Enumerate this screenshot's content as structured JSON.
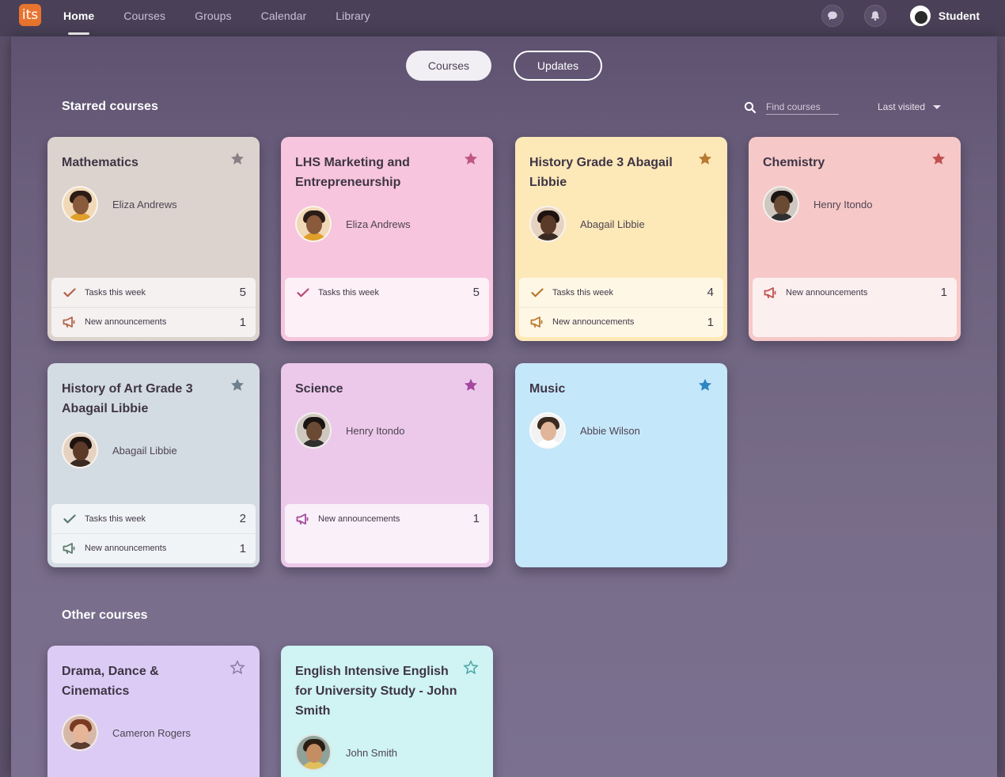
{
  "topbar": {
    "logo_text": "its",
    "nav": [
      {
        "label": "Home",
        "active": true
      },
      {
        "label": "Courses"
      },
      {
        "label": "Groups"
      },
      {
        "label": "Calendar"
      },
      {
        "label": "Library"
      }
    ],
    "icons": {
      "messages": "chat-bubble-icon",
      "notifications": "bell-icon"
    },
    "user_label": "Student"
  },
  "view_toggle": {
    "courses_label": "Courses",
    "updates_label": "Updates",
    "selected": "Courses"
  },
  "starred": {
    "title": "Starred courses",
    "search_placeholder": "Find courses",
    "sort_label": "Last visited"
  },
  "other": {
    "title": "Other courses"
  },
  "stat_labels": {
    "tasks": "Tasks this week",
    "announcements": "New announcements"
  },
  "courses": [
    {
      "id": "mathematics",
      "title": "Mathematics",
      "teacher": "Eliza Andrews",
      "starred": true,
      "tasks": "5",
      "announcements": "1",
      "bg": "#dcd3cf",
      "star_color": "#8a7f85",
      "stats_bg": "#f4f1f0",
      "accent": "#b5634a"
    },
    {
      "id": "lhs-marketing",
      "title": "LHS Marketing and Entrepreneurship",
      "teacher": "Eliza Andrews",
      "starred": true,
      "tasks": "5",
      "bg": "#f7c5dd",
      "star_color": "#c0577f",
      "stats_bg": "#fdf0f6",
      "accent": "#b84a7a"
    },
    {
      "id": "history-grade-3",
      "title": "History Grade 3 Abagail Libbie",
      "teacher": "Abagail Libbie",
      "starred": true,
      "tasks": "4",
      "announcements": "1",
      "bg": "#fde8b8",
      "star_color": "#b87a2e",
      "stats_bg": "#fff7e6",
      "accent": "#b87a2e"
    },
    {
      "id": "chemistry",
      "title": "Chemistry",
      "teacher": "Henry Itondo",
      "starred": true,
      "announcements": "1",
      "bg": "#f6c8c8",
      "star_color": "#c0504e",
      "stats_bg": "#fcefef",
      "accent": "#c0504e"
    },
    {
      "id": "history-of-art",
      "title": "History of Art Grade 3 Abagail Libbie",
      "teacher": "Abagail Libbie",
      "starred": true,
      "tasks": "2",
      "announcements": "1",
      "bg": "#d4dce3",
      "star_color": "#6f7f8e",
      "stats_bg": "#f1f4f6",
      "accent": "#5b7a6e"
    },
    {
      "id": "science",
      "title": "Science",
      "teacher": "Henry Itondo",
      "starred": true,
      "announcements": "1",
      "bg": "#ecc9ea",
      "star_color": "#a5479e",
      "stats_bg": "#faf0f9",
      "accent": "#a5479e"
    },
    {
      "id": "music",
      "title": "Music",
      "teacher": "Abbie Wilson",
      "starred": true,
      "bg": "#c5e7fa",
      "star_color": "#2f86c4",
      "stats_bg": "#eef8fd",
      "accent": "#2f86c4"
    },
    {
      "id": "drama",
      "title": "Drama, Dance & Cinematics",
      "teacher": "Cameron Rogers",
      "starred": false,
      "bg": "#dcccf5",
      "star_color": "#8a7aa7",
      "stats_bg": "#f3eefc",
      "accent": "#8a7aa7"
    },
    {
      "id": "english",
      "title": "English Intensive English for University Study - John Smith",
      "teacher": "John Smith",
      "starred": false,
      "bg": "#d0f3f3",
      "star_color": "#4aa5a5",
      "stats_bg": "#effbfb",
      "accent": "#4aa5a5"
    }
  ]
}
